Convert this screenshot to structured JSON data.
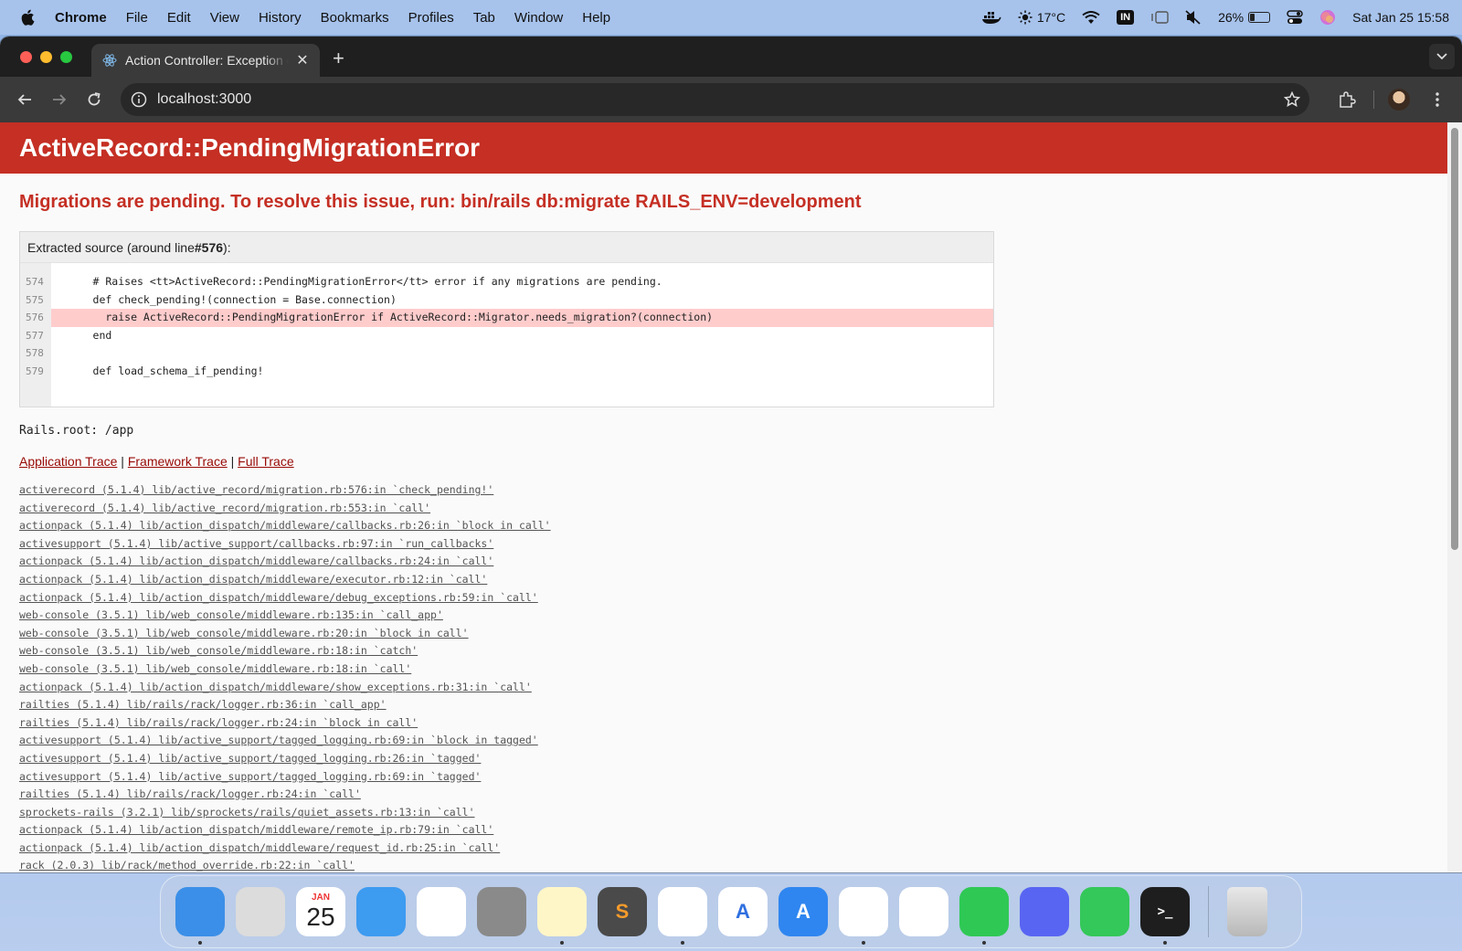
{
  "menubar": {
    "app_name": "Chrome",
    "items": [
      "File",
      "Edit",
      "View",
      "History",
      "Bookmarks",
      "Profiles",
      "Tab",
      "Window",
      "Help"
    ],
    "weather": "17°C",
    "input_source": "IN",
    "battery_percent": "26%",
    "battery_level": 0.26,
    "datetime": "Sat Jan 25  15:58"
  },
  "browser": {
    "tab_title": "Action Controller: Exception caught",
    "url": "localhost:3000"
  },
  "page": {
    "exception_name": "ActiveRecord::PendingMigrationError",
    "message": "Migrations are pending. To resolve this issue, run: bin/rails db:migrate RAILS_ENV=development",
    "source_label_prefix": "Extracted source (around line ",
    "source_label_line": "#576",
    "source_label_suffix": "):",
    "source_lines": [
      {
        "num": "574",
        "code": "      # Raises <tt>ActiveRecord::PendingMigrationError</tt> error if any migrations are pending."
      },
      {
        "num": "575",
        "code": "      def check_pending!(connection = Base.connection)"
      },
      {
        "num": "576",
        "code": "        raise ActiveRecord::PendingMigrationError if ActiveRecord::Migrator.needs_migration?(connection)"
      },
      {
        "num": "577",
        "code": "      end"
      },
      {
        "num": "578",
        "code": ""
      },
      {
        "num": "579",
        "code": "      def load_schema_if_pending!"
      }
    ],
    "rails_root": "Rails.root: /app",
    "trace_links": {
      "application": "Application Trace",
      "framework": "Framework Trace",
      "full": "Full Trace",
      "separator": " | "
    },
    "trace": [
      "activerecord (5.1.4) lib/active_record/migration.rb:576:in `check_pending!'",
      "activerecord (5.1.4) lib/active_record/migration.rb:553:in `call'",
      "actionpack (5.1.4) lib/action_dispatch/middleware/callbacks.rb:26:in `block in call'",
      "activesupport (5.1.4) lib/active_support/callbacks.rb:97:in `run_callbacks'",
      "actionpack (5.1.4) lib/action_dispatch/middleware/callbacks.rb:24:in `call'",
      "actionpack (5.1.4) lib/action_dispatch/middleware/executor.rb:12:in `call'",
      "actionpack (5.1.4) lib/action_dispatch/middleware/debug_exceptions.rb:59:in `call'",
      "web-console (3.5.1) lib/web_console/middleware.rb:135:in `call_app'",
      "web-console (3.5.1) lib/web_console/middleware.rb:20:in `block in call'",
      "web-console (3.5.1) lib/web_console/middleware.rb:18:in `catch'",
      "web-console (3.5.1) lib/web_console/middleware.rb:18:in `call'",
      "actionpack (5.1.4) lib/action_dispatch/middleware/show_exceptions.rb:31:in `call'",
      "railties (5.1.4) lib/rails/rack/logger.rb:36:in `call_app'",
      "railties (5.1.4) lib/rails/rack/logger.rb:24:in `block in call'",
      "activesupport (5.1.4) lib/active_support/tagged_logging.rb:69:in `block in tagged'",
      "activesupport (5.1.4) lib/active_support/tagged_logging.rb:26:in `tagged'",
      "activesupport (5.1.4) lib/active_support/tagged_logging.rb:69:in `tagged'",
      "railties (5.1.4) lib/rails/rack/logger.rb:24:in `call'",
      "sprockets-rails (3.2.1) lib/sprockets/rails/quiet_assets.rb:13:in `call'",
      "actionpack (5.1.4) lib/action_dispatch/middleware/remote_ip.rb:79:in `call'",
      "actionpack (5.1.4) lib/action_dispatch/middleware/request_id.rb:25:in `call'",
      "rack (2.0.3) lib/rack/method_override.rb:22:in `call'"
    ]
  },
  "dock": {
    "calendar_month": "JAN",
    "calendar_day": "25",
    "apps": [
      {
        "name": "finder-app",
        "bg": "#3b8fe8",
        "label": "",
        "running": true
      },
      {
        "name": "launchpad-app",
        "bg": "#dcdcdc",
        "label": "",
        "running": false
      },
      {
        "name": "calendar-app",
        "bg": "#ffffff",
        "label": "",
        "running": false
      },
      {
        "name": "mail-app",
        "bg": "#3d9bf0",
        "label": "",
        "running": false
      },
      {
        "name": "reminders-app",
        "bg": "#ffffff",
        "label": "",
        "running": false
      },
      {
        "name": "system-settings-app",
        "bg": "#8a8a8a",
        "label": "",
        "running": false
      },
      {
        "name": "notes-app",
        "bg": "#fff6c8",
        "label": "",
        "running": true
      },
      {
        "name": "sublime-text-app",
        "bg": "#4a4a4a",
        "label": "S",
        "running": false
      },
      {
        "name": "vscode-app",
        "bg": "#ffffff",
        "label": "",
        "running": true
      },
      {
        "name": "xcode-instruments-app",
        "bg": "#ffffff",
        "label": "A",
        "running": false
      },
      {
        "name": "app-store-app",
        "bg": "#2f86f0",
        "label": "A",
        "running": false
      },
      {
        "name": "chrome-app",
        "bg": "#ffffff",
        "label": "",
        "running": true
      },
      {
        "name": "safari-app",
        "bg": "#ffffff",
        "label": "",
        "running": false
      },
      {
        "name": "whatsapp-app",
        "bg": "#2fc855",
        "label": "",
        "running": true
      },
      {
        "name": "discord-app",
        "bg": "#5865f2",
        "label": "",
        "running": false
      },
      {
        "name": "facetime-app",
        "bg": "#34c759",
        "label": "",
        "running": false
      },
      {
        "name": "terminal-app",
        "bg": "#1e1e1e",
        "label": ">_",
        "running": true
      }
    ]
  },
  "colors": {
    "header_bg": "#c52f24",
    "link": "#980905",
    "highlight": "#ffcccc"
  }
}
